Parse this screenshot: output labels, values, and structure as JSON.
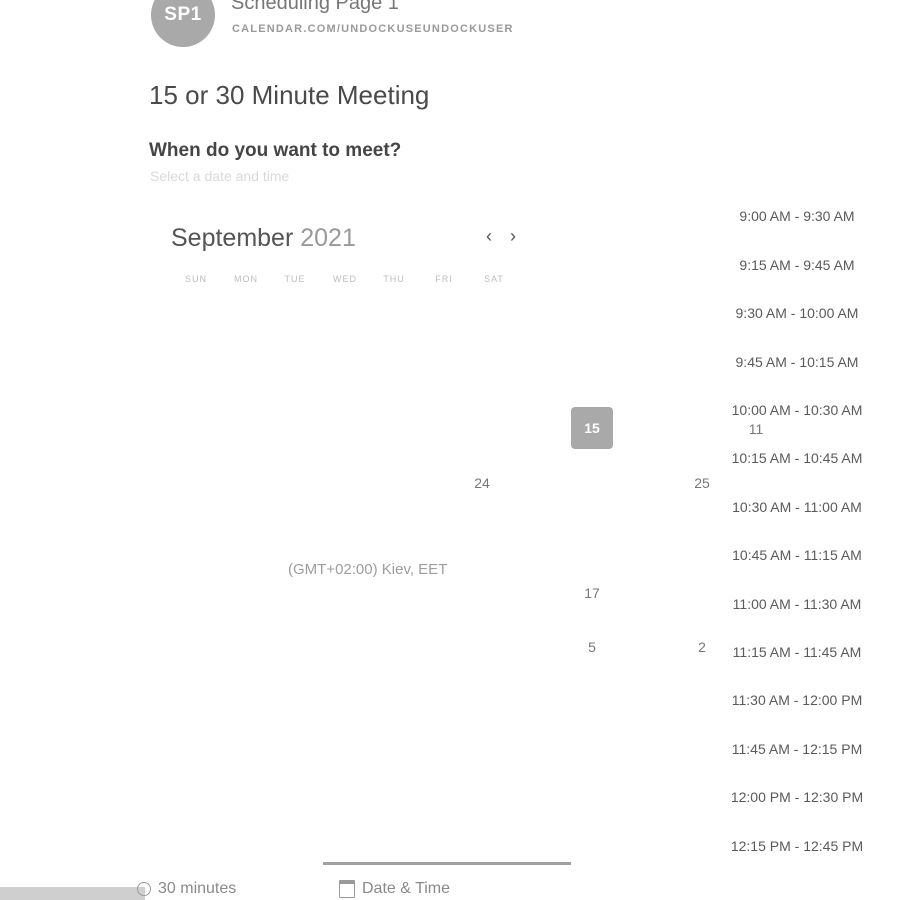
{
  "header": {
    "avatar_initials": "SP1",
    "page_name": "Scheduling Page 1",
    "page_url": "CALENDAR.COM/UNDOCKUSEUNDOCKUSER"
  },
  "meeting": {
    "title": "15 or 30 Minute Meeting",
    "question": "When do you want to meet?",
    "hint": "Select a date and time"
  },
  "calendar": {
    "month": "September",
    "year": "2021",
    "prev_icon": "chevron-left-icon",
    "next_icon": "chevron-right-icon",
    "prev_glyph": "‹",
    "next_glyph": "›",
    "weekdays": [
      "SUN",
      "MON",
      "TUE",
      "WED",
      "THU",
      "FRI",
      "SAT"
    ],
    "selected_day": "15",
    "visible_days": [
      "15",
      "11",
      "24",
      "25",
      "17",
      "5",
      "2"
    ]
  },
  "timezone": "(GMT+02:00) Kiev, EET",
  "time_slots": [
    "9:00 AM - 9:30 AM",
    "9:15 AM - 9:45 AM",
    "9:30 AM - 10:00 AM",
    "9:45 AM - 10:15 AM",
    "10:00 AM - 10:30 AM",
    "10:15 AM - 10:45 AM",
    "10:30 AM - 11:00 AM",
    "10:45 AM - 11:15 AM",
    "11:00 AM - 11:30 AM",
    "11:15 AM - 11:45 AM",
    "11:30 AM - 12:00 PM",
    "11:45 AM - 12:15 PM",
    "12:00 PM - 12:30 PM",
    "12:15 PM - 12:45 PM"
  ],
  "steps": {
    "duration_label": "30 minutes",
    "datetime_label": "Date & Time",
    "duration_icon": "clock-icon",
    "datetime_icon": "calendar-icon"
  },
  "colors": {
    "accent": "#a9a9a9",
    "background": "#ffffff"
  }
}
